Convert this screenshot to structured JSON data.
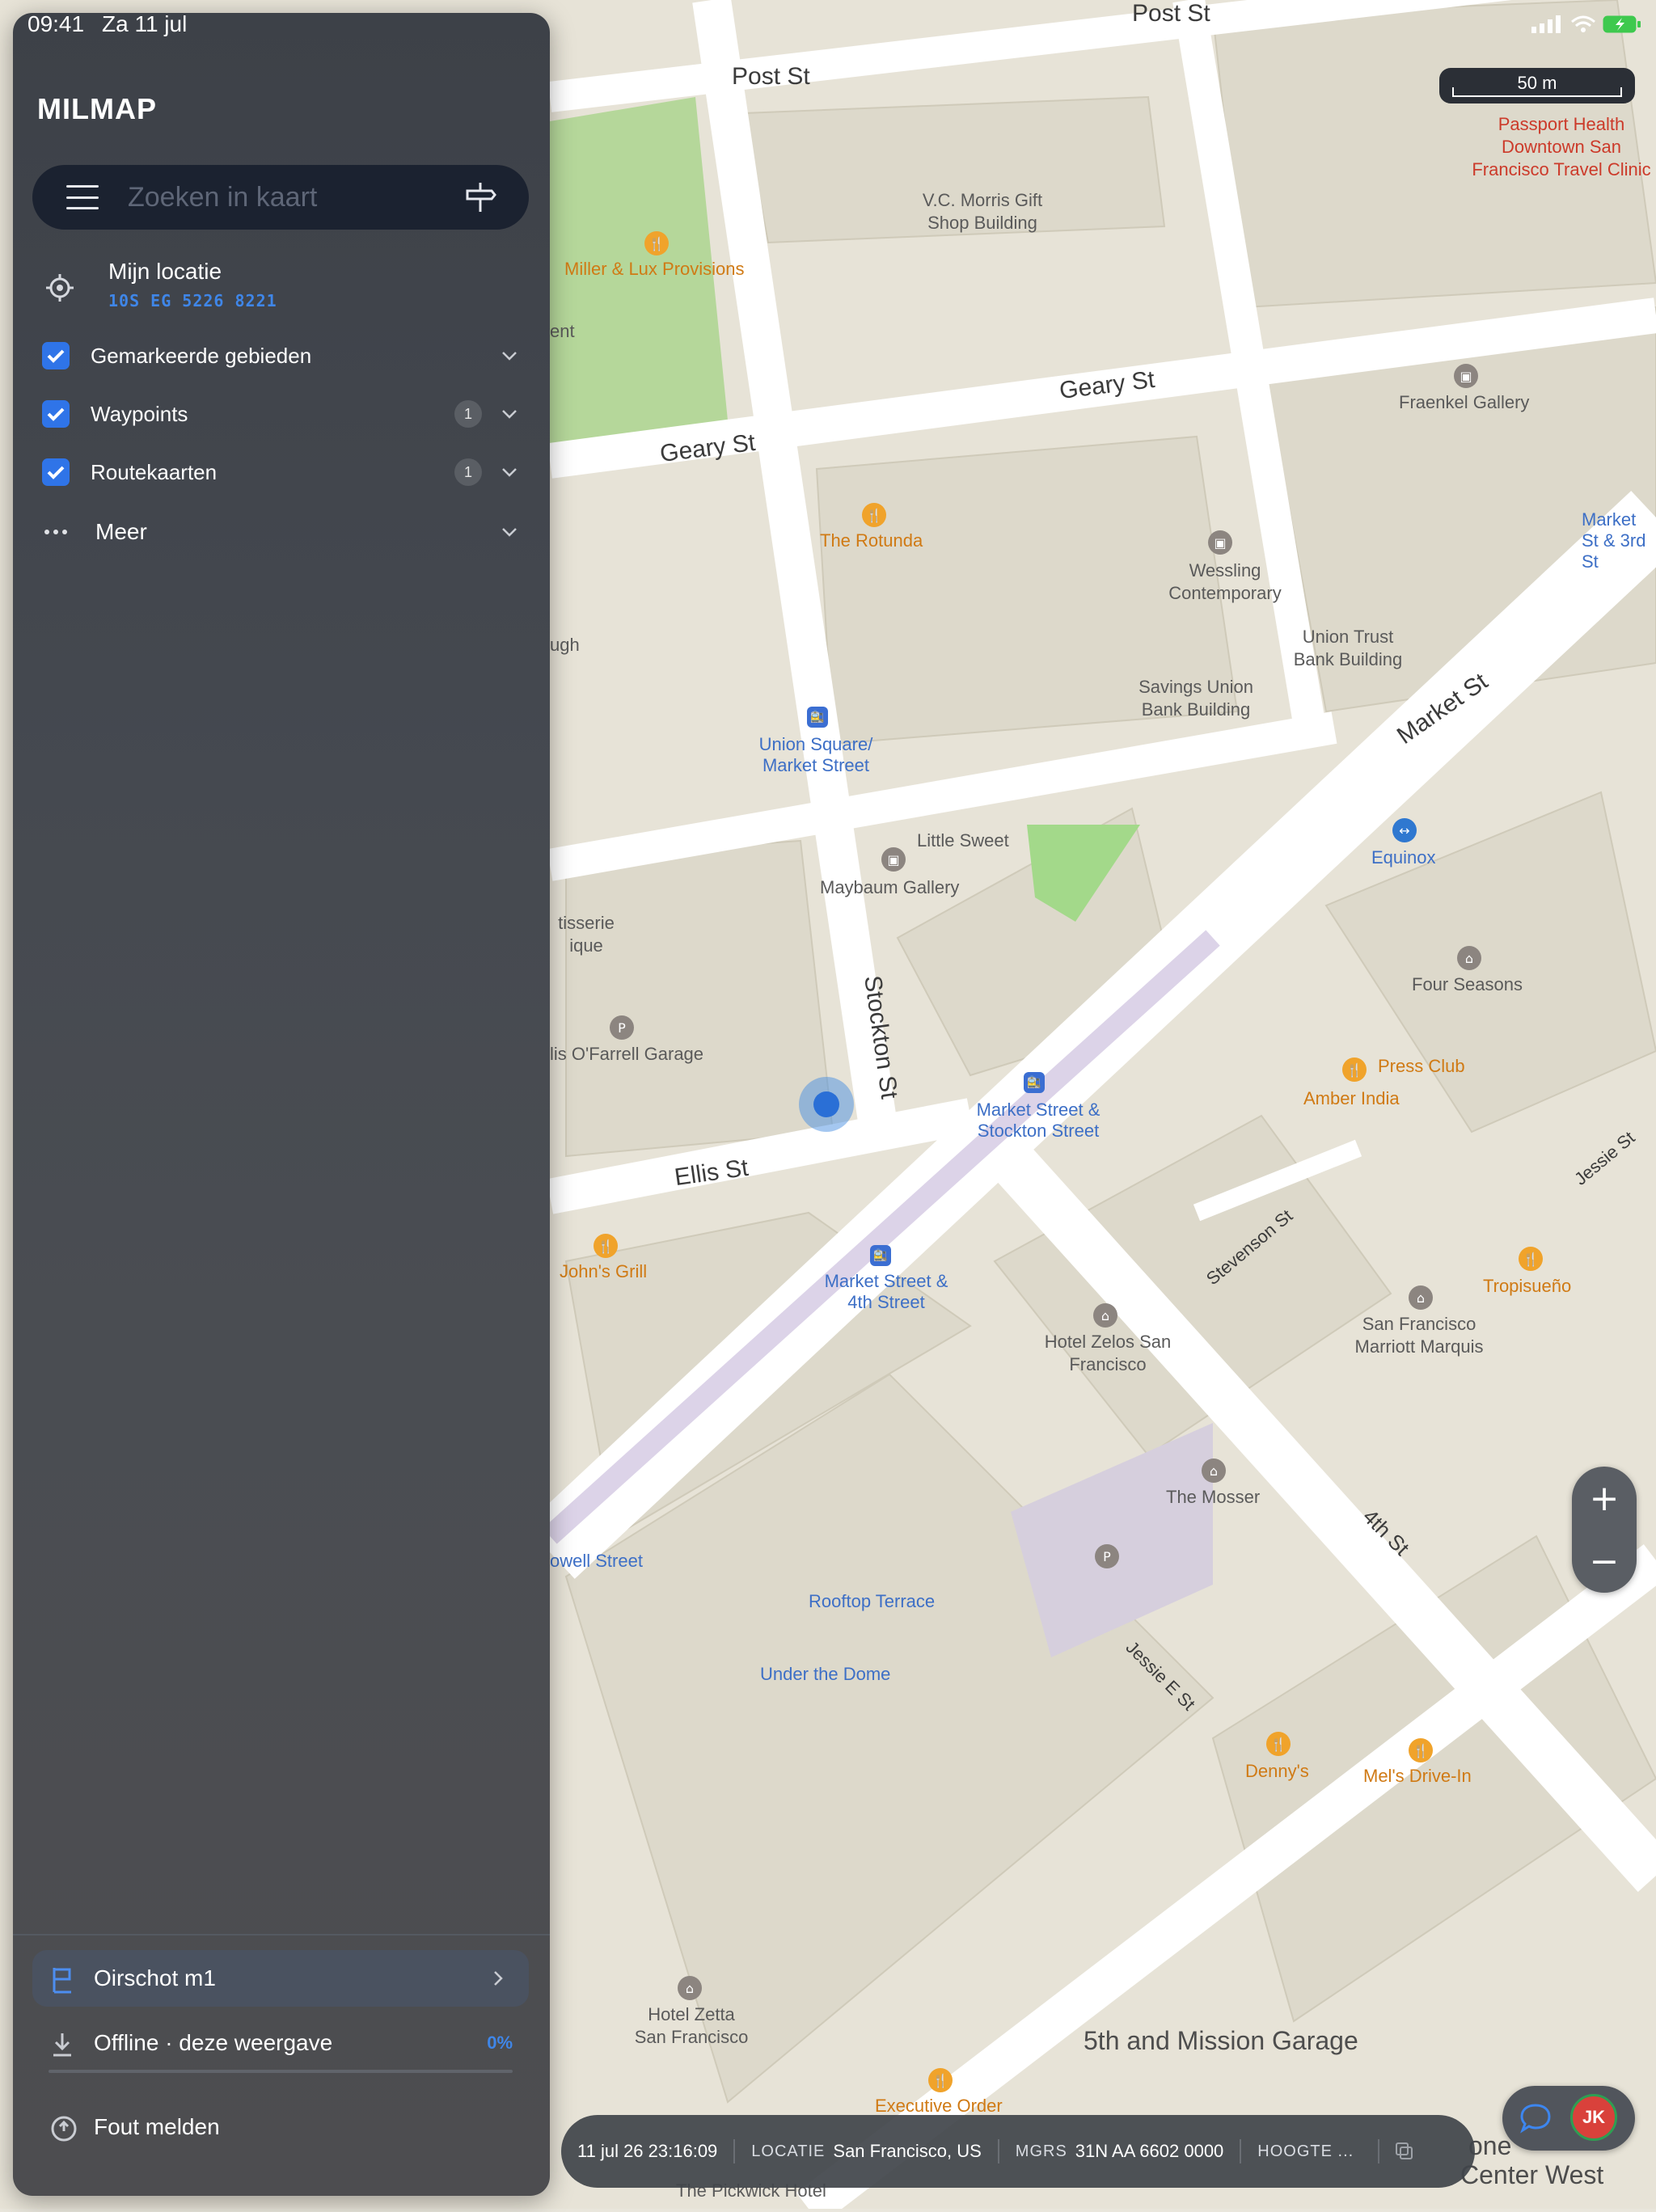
{
  "status_bar": {
    "time": "09:41",
    "date": "Za 11 jul"
  },
  "app": {
    "name": "MILMAP"
  },
  "search": {
    "placeholder": "Zoeken in kaart"
  },
  "my_location": {
    "title": "Mijn locatie",
    "grid_ref": "10S EG 5226 8221"
  },
  "layers": [
    {
      "label": "Gemarkeerde gebieden",
      "checked": true,
      "count": null
    },
    {
      "label": "Waypoints",
      "checked": true,
      "count": "1"
    },
    {
      "label": "Routekaarten",
      "checked": true,
      "count": "1"
    }
  ],
  "more": {
    "label": "Meer"
  },
  "bottom": {
    "route": {
      "label": "Oirschot m1"
    },
    "offline": {
      "label": "Offline · deze weergave",
      "percent": "0%"
    },
    "report": {
      "label": "Fout melden"
    }
  },
  "scale": {
    "label": "50 m"
  },
  "zoom": {
    "in": "+",
    "out": "−"
  },
  "info_bar": {
    "datetime": "11 jul 26 23:16:09",
    "location_key": "LOCATIE",
    "location_value": "San Francisco, US",
    "mgrs_key": "MGRS",
    "mgrs_value": "31N AA 6602 0000",
    "height_key": "HOOGTE ..."
  },
  "user": {
    "initials": "JK"
  },
  "map": {
    "streets": [
      "Post St",
      "Geary St",
      "Geary St",
      "Market St",
      "Stockton St",
      "Ellis St",
      "Stevenson St",
      "4th St",
      "Jessie St",
      "Jessie E St"
    ],
    "places": {
      "orange": [
        "Miller & Lux Provisions",
        "The Rotunda",
        "John's Grill",
        "Press Club",
        "Amber India",
        "Tropisueño",
        "Denny's",
        "Mel's Drive-In",
        "Executive Order"
      ],
      "blue": [
        "Union Square/ Market Street",
        "Market Street & Stockton Street",
        "Market Street & 4th Street",
        "Equinox",
        "Market St & 3rd St",
        "Rooftop Terrace",
        "Under the Dome",
        "owell Street"
      ],
      "gray": [
        "V.C. Morris Gift Shop Building",
        "Wessling Contemporary",
        "Union Trust Bank Building",
        "Savings Union Bank Building",
        "Fraenkel Gallery",
        "Little Sweet",
        "Maybaum Gallery",
        "Four Seasons",
        "Hotel Zelos San Francisco",
        "San Francisco Marriott Marquis",
        "The Mosser",
        "Hotel Zetta San Francisco",
        "lis O'Farrell Garage",
        "tisserie ique",
        "ugh",
        "ent",
        "The Pickwick Hotel"
      ],
      "red": [
        "Passport Health Downtown San Francisco Travel Clinic"
      ],
      "big": [
        "5th and Mission Garage",
        "Center West",
        "one"
      ]
    }
  }
}
